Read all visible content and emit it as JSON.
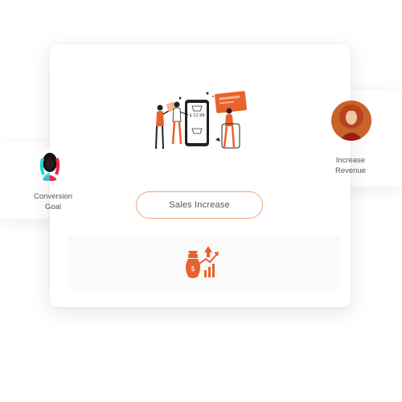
{
  "main_card": {
    "button_label": "Sales Increase",
    "illustration_screen_text": "$ 12.99"
  },
  "left_profile": {
    "line1": "Conversion",
    "line2": "Goal"
  },
  "right_profile": {
    "line1": "Increase",
    "line2": "Revenue"
  },
  "colors": {
    "accent": "#e8622c",
    "pill_border": "#e9a77b",
    "text": "#555555"
  },
  "icons": {
    "illustration": "sales-team-illustration",
    "growth": "money-bag-growth-icon"
  }
}
